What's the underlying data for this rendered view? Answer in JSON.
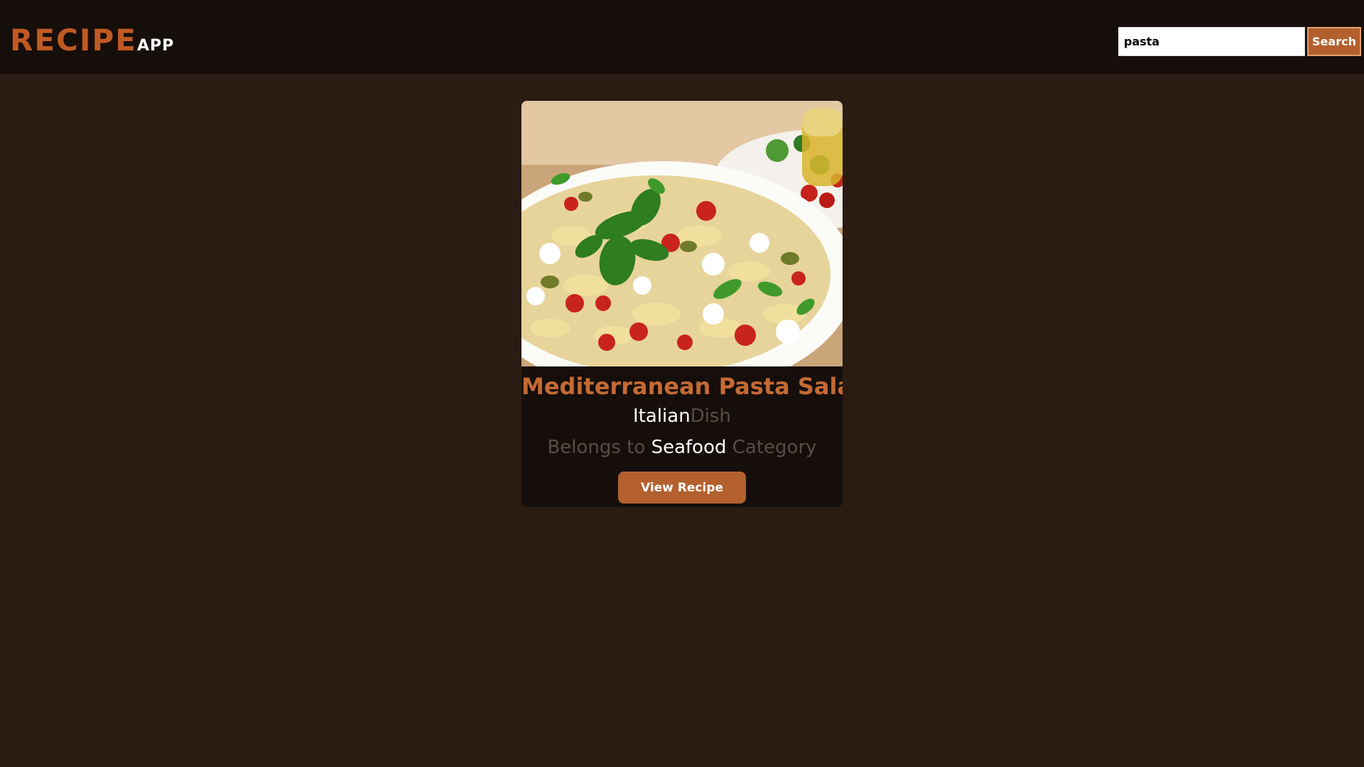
{
  "header": {
    "logo_main": "RECIPE",
    "logo_sub": "APP",
    "search": {
      "value": "pasta",
      "button_label": "Search"
    }
  },
  "results": [
    {
      "title": "Mediterranean Pasta Salad",
      "area": "Italian",
      "area_suffix": "Dish",
      "category_prefix": "Belongs to",
      "category": "Seafood",
      "category_suffix": "Category",
      "button_label": "View Recipe",
      "image": "pasta-salad-photo"
    }
  ],
  "colors": {
    "page_background": "#2a1c12",
    "header_background": "#160e0a",
    "accent": "#b3602e",
    "logo": "#c05a23",
    "title": "#c46a35"
  }
}
